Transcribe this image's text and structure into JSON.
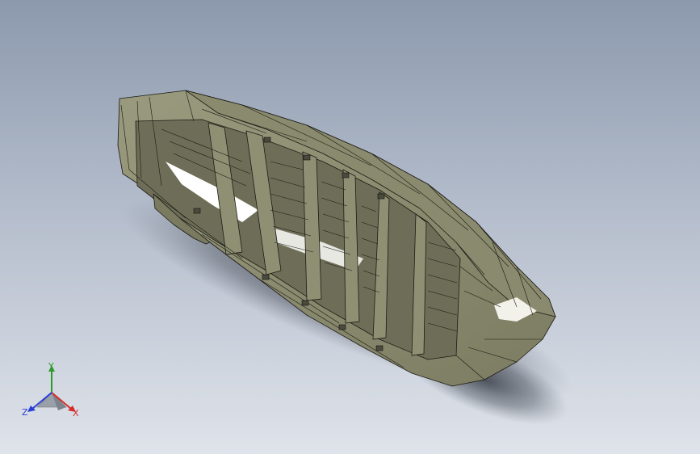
{
  "viewport": {
    "background_top": "#8c99ad",
    "background_bottom": "#dfe3ea",
    "model": {
      "description_icon": "hull-model-icon",
      "body_color": "#8e8e72",
      "edge_color": "#1a1a14",
      "highlight_color": "#ffffff"
    }
  },
  "triad": {
    "x_label": "X",
    "y_label": "Y",
    "z_label": "Z",
    "x_color": "#d42a2a",
    "y_color": "#2e9a2e",
    "z_color": "#2a3fd4"
  }
}
